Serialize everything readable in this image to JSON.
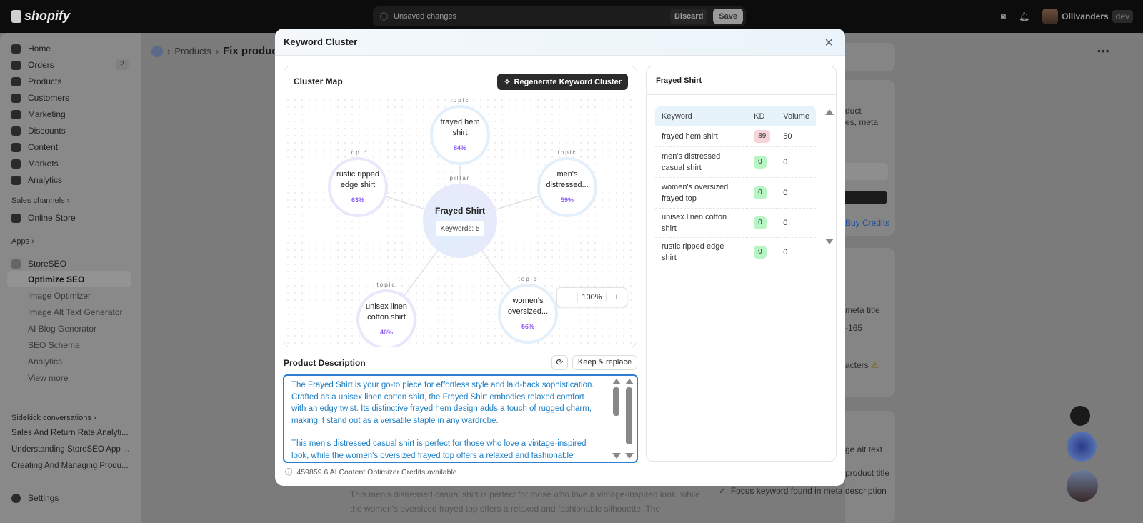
{
  "topbar": {
    "brand": "shopify",
    "unsaved": "Unsaved changes",
    "discard": "Discard",
    "save": "Save",
    "store": "Ollivanders",
    "store_tag": "dev"
  },
  "sidebar": {
    "items": [
      {
        "label": "Home",
        "icon": "home-icon"
      },
      {
        "label": "Orders",
        "icon": "inbox-icon",
        "badge": "2"
      },
      {
        "label": "Products",
        "icon": "tag-icon"
      },
      {
        "label": "Customers",
        "icon": "person-icon"
      },
      {
        "label": "Marketing",
        "icon": "target-icon"
      },
      {
        "label": "Discounts",
        "icon": "discount-icon"
      },
      {
        "label": "Content",
        "icon": "image-icon"
      },
      {
        "label": "Markets",
        "icon": "globe-icon"
      },
      {
        "label": "Analytics",
        "icon": "bar-chart-icon"
      }
    ],
    "sales_channels": "Sales channels",
    "online_store": "Online Store",
    "apps": "Apps",
    "app_name": "StoreSEO",
    "app_items": [
      "Optimize SEO",
      "Image Optimizer",
      "Image Alt Text Generator",
      "AI Blog Generator",
      "SEO Schema",
      "Analytics",
      "View more"
    ],
    "sidekick": "Sidekick conversations",
    "conversations": [
      "Sales And Return Rate Analyti...",
      "Understanding StoreSEO App ...",
      "Creating And Managing Produ..."
    ],
    "settings": "Settings"
  },
  "breadcrumb": {
    "parent": "Products",
    "current": "Fix product"
  },
  "background": {
    "right_fragments": [
      "duct",
      "es, meta",
      "Buy Credits",
      "meta title",
      "-165",
      "acters",
      "ge alt text",
      "product title",
      "Focus keyword found in meta description"
    ],
    "desc_fragment": "This men's distressed casual shirt is perfect for those who love a vintage-inspired look, while the women's oversized frayed top offers a relaxed and fashionable silhouette. The"
  },
  "modal": {
    "title": "Keyword Cluster",
    "cluster_map": {
      "title": "Cluster Map",
      "regenerate": "Regenerate Keyword Cluster",
      "pillar": {
        "tag": "pillar",
        "name": "Frayed Shirt",
        "keywords": "Keywords: 5"
      },
      "topics": [
        {
          "tag": "topic",
          "name": "frayed hem shirt",
          "pct": "84%"
        },
        {
          "tag": "topic",
          "name": "rustic ripped edge shirt",
          "pct": "63%"
        },
        {
          "tag": "topic",
          "name": "men's distressed...",
          "pct": "59%"
        },
        {
          "tag": "topic",
          "name": "unisex linen cotton shirt",
          "pct": "46%"
        },
        {
          "tag": "topic",
          "name": "women's oversized...",
          "pct": "56%"
        }
      ],
      "zoom": {
        "minus": "−",
        "level": "100%",
        "plus": "+"
      }
    },
    "description": {
      "label": "Product Description",
      "keep": "Keep & replace",
      "paragraphs": [
        "The Frayed Shirt is your go-to piece for effortless style and laid-back sophistication. Crafted as a unisex linen cotton shirt, the Frayed Shirt embodies relaxed comfort with an edgy twist. Its distinctive frayed hem design adds a touch of rugged charm, making it stand out as a versatile staple in any wardrobe.",
        "This men's distressed casual shirt is perfect for those who love a vintage-inspired look, while the women's oversized frayed top offers a relaxed and fashionable"
      ],
      "credits": "459859.6 AI Content Optimizer Credits available"
    },
    "keywords": {
      "title": "Frayed Shirt",
      "headers": [
        "Keyword",
        "KD",
        "Volume"
      ],
      "rows": [
        {
          "keyword": "frayed hem shirt",
          "kd": "89",
          "volume": "50",
          "kd_color": "#f6d4d8"
        },
        {
          "keyword": "men's distressed casual shirt",
          "kd": "0",
          "volume": "0",
          "kd_color": "#b8f5c4"
        },
        {
          "keyword": "women's oversized frayed top",
          "kd": "0",
          "volume": "0",
          "kd_color": "#b8f5c4"
        },
        {
          "keyword": "unisex linen cotton shirt",
          "kd": "0",
          "volume": "0",
          "kd_color": "#b8f5c4"
        },
        {
          "keyword": "rustic ripped edge shirt",
          "kd": "0",
          "volume": "0",
          "kd_color": "#b8f5c4"
        }
      ]
    }
  }
}
